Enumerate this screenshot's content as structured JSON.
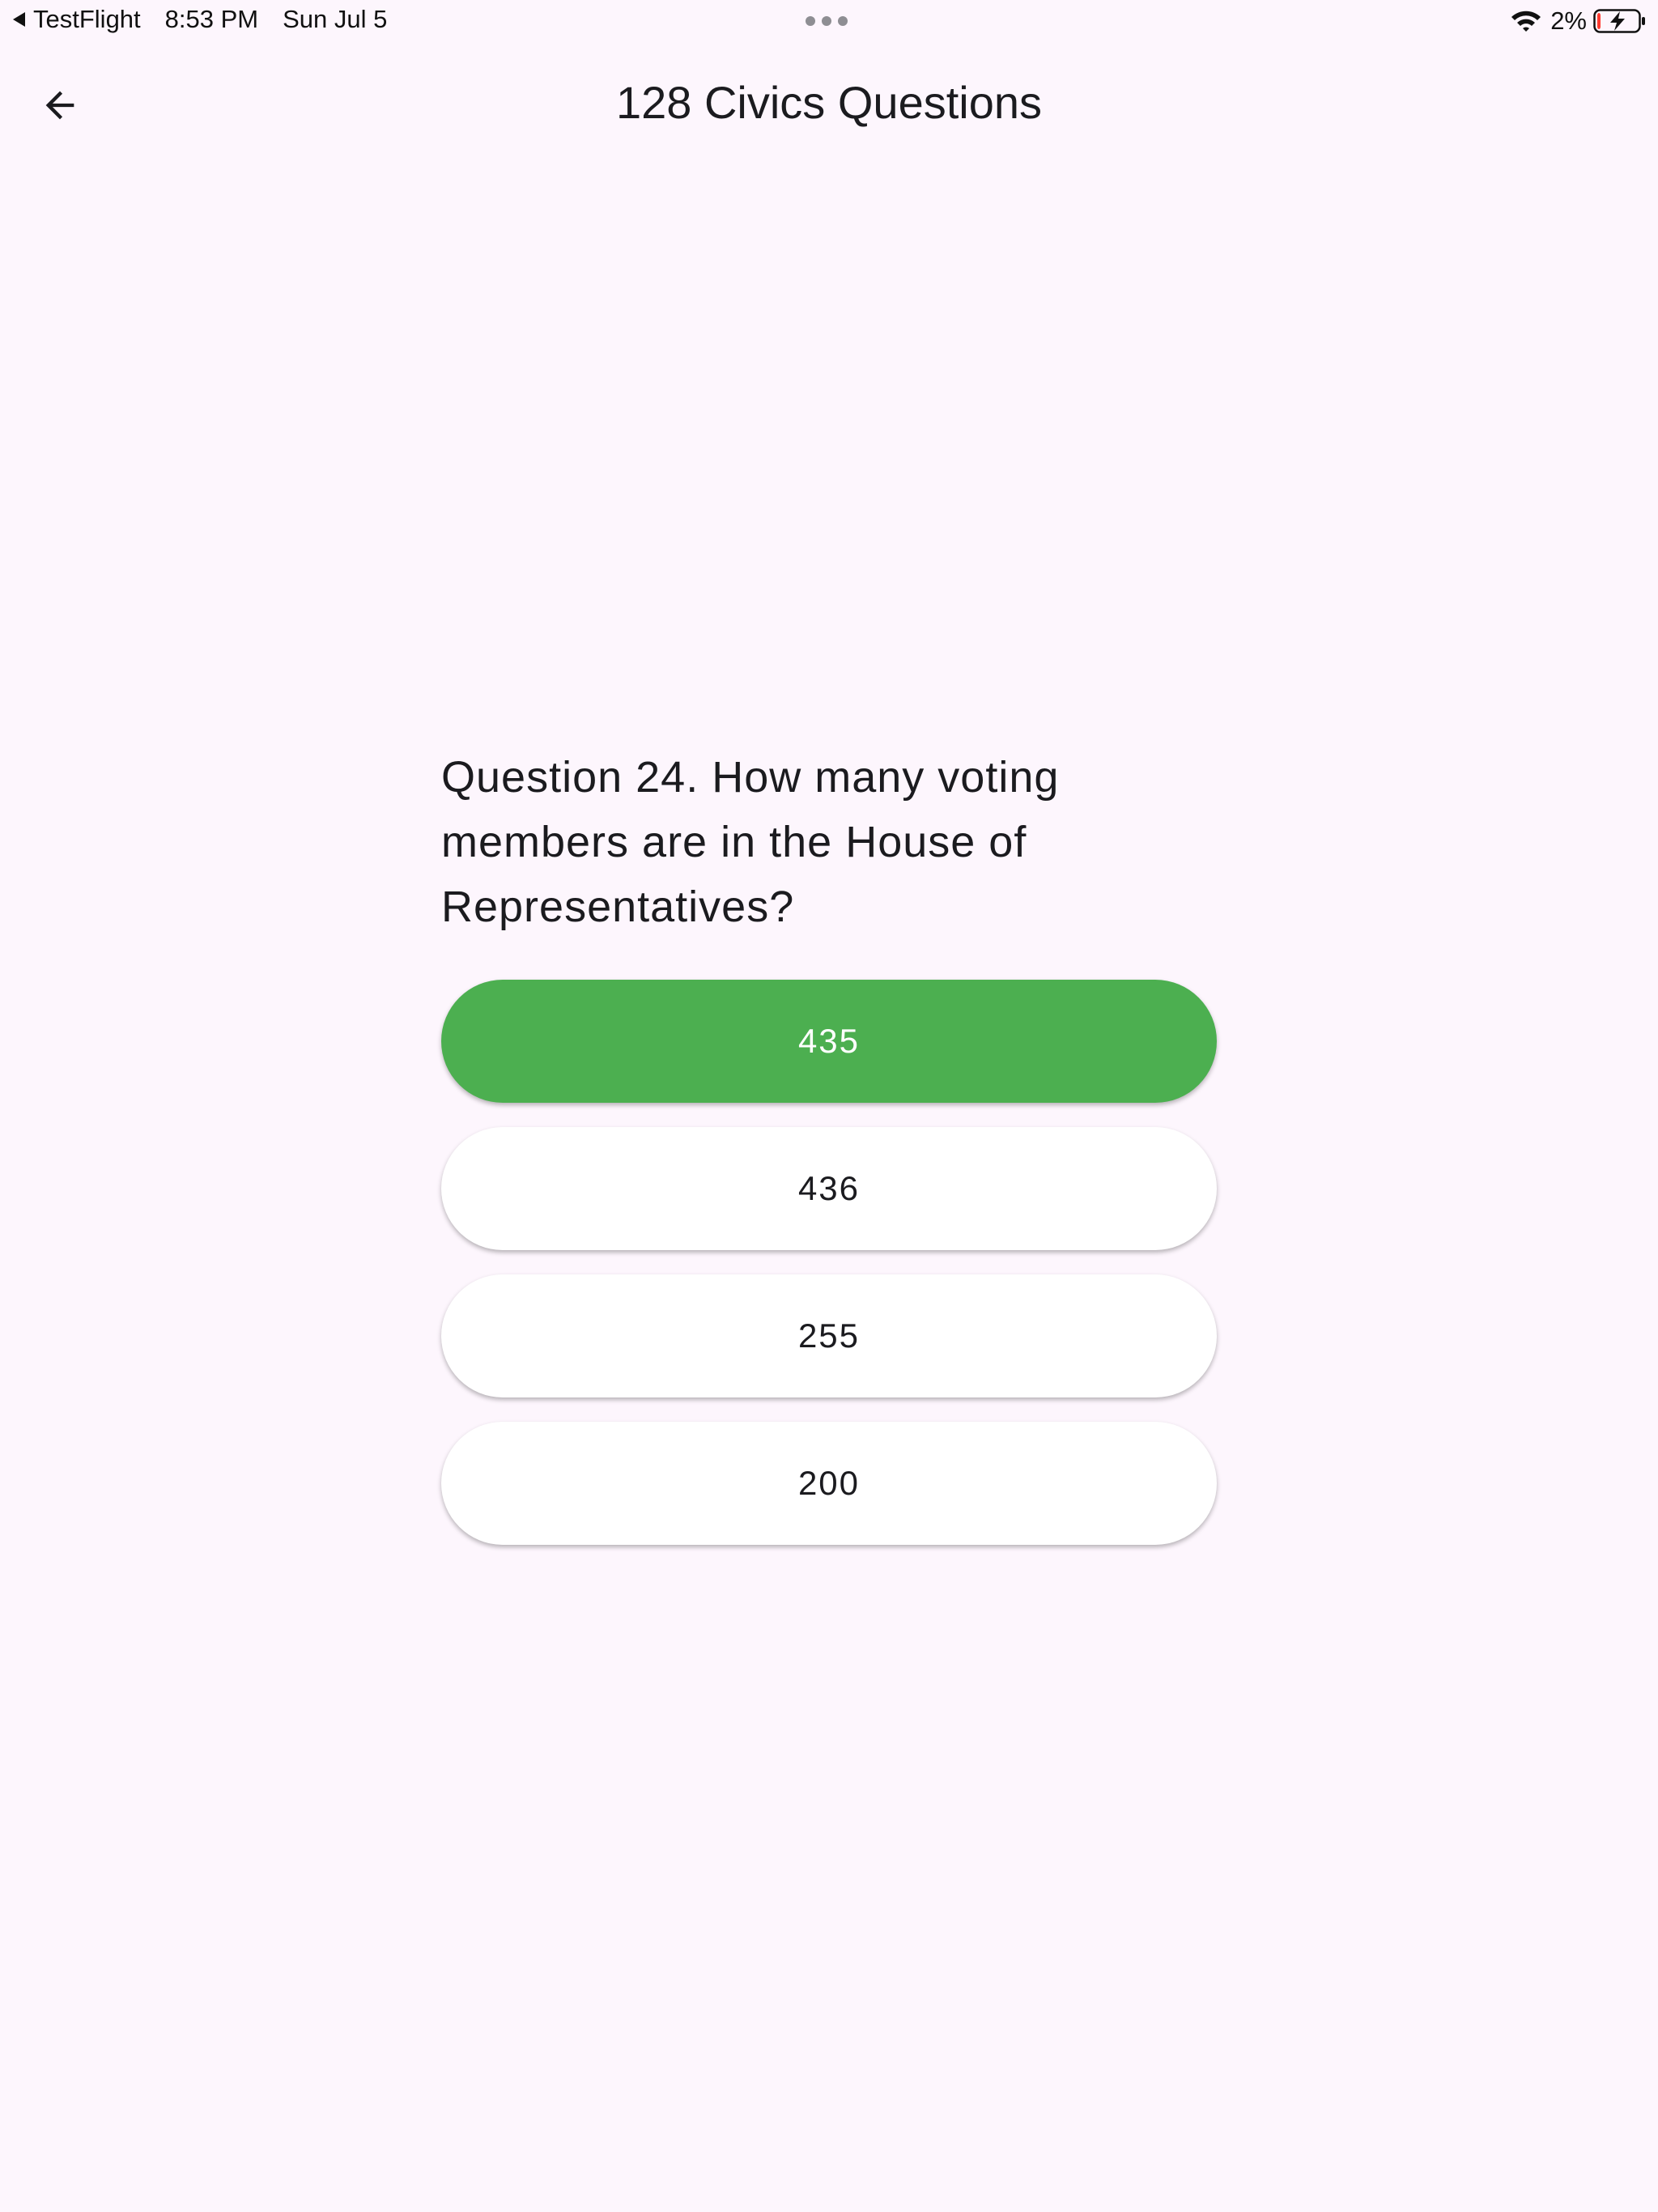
{
  "status_bar": {
    "back_app": "TestFlight",
    "time": "8:53 PM",
    "date": "Sun Jul 5",
    "battery_percent": "2%",
    "battery_level": 0.02,
    "charging": true,
    "icons": [
      "back-triangle-icon",
      "more-dots-icon",
      "wifi-icon",
      "battery-charging-icon"
    ]
  },
  "app_bar": {
    "title": "128 Civics Questions",
    "back_icon": "arrow-back-icon"
  },
  "question": {
    "text": "Question 24. How many voting members are in the House of Representatives?"
  },
  "answers": [
    {
      "label": "435",
      "state": "correct"
    },
    {
      "label": "436",
      "state": "default"
    },
    {
      "label": "255",
      "state": "default"
    },
    {
      "label": "200",
      "state": "default"
    }
  ],
  "colors": {
    "background": "#fdf6fd",
    "correct": "#4caf50",
    "button": "#ffffff",
    "text": "#1b1b1f"
  }
}
